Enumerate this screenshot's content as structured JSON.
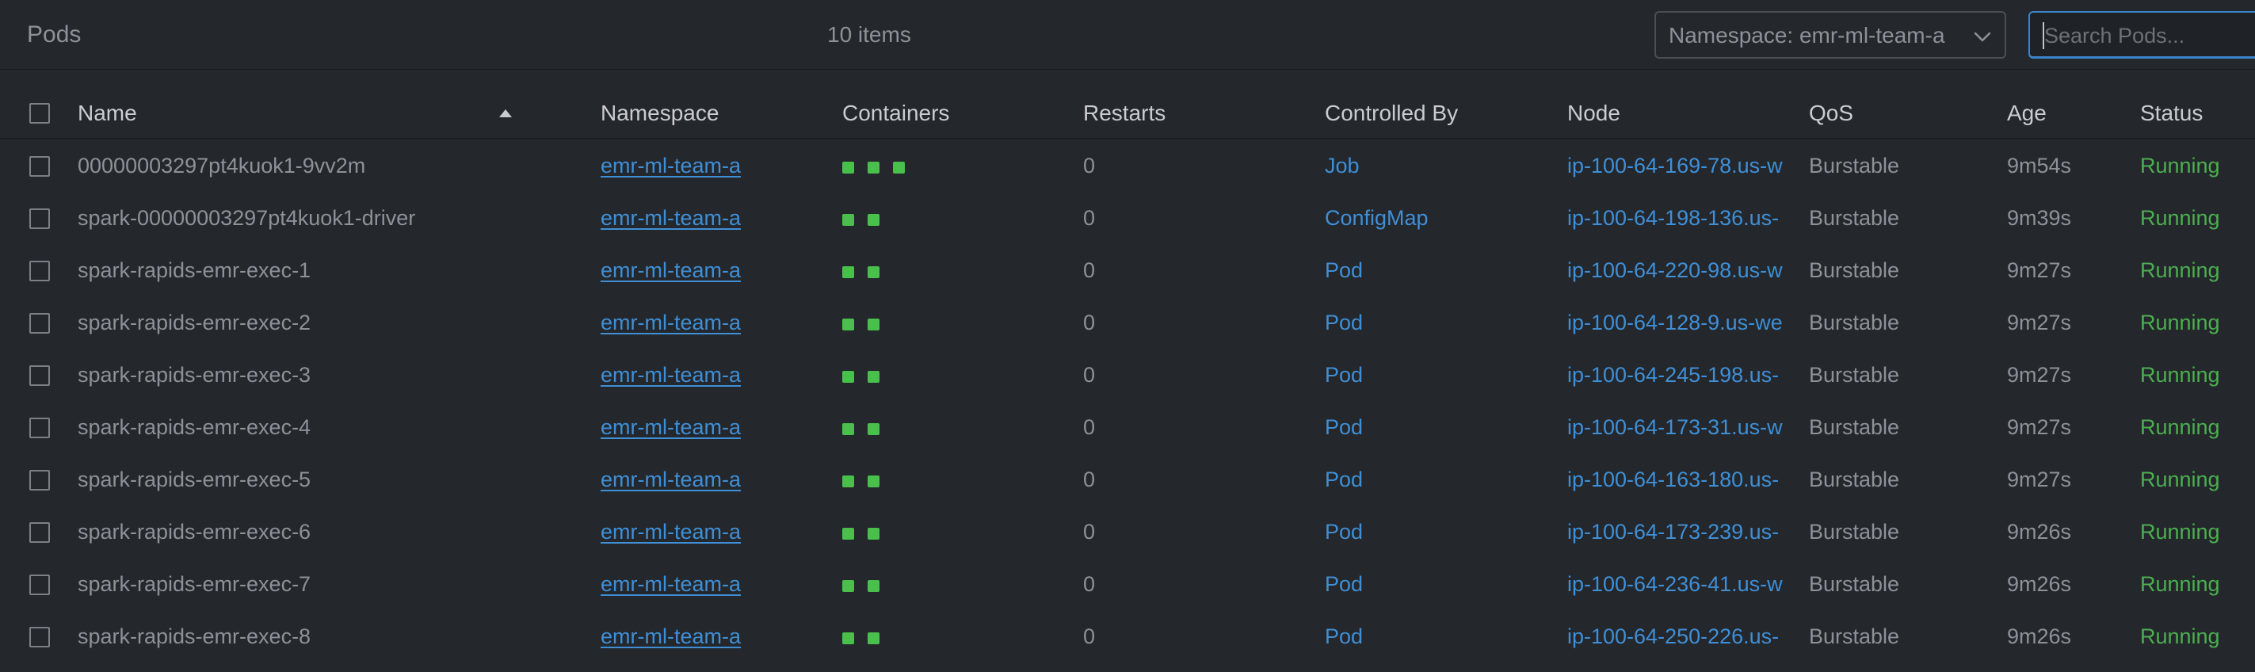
{
  "header": {
    "title": "Pods",
    "item_count": "10 items",
    "namespace_select": "Namespace: emr-ml-team-a",
    "search_placeholder": "Search Pods..."
  },
  "colors": {
    "background": "#24272c",
    "link": "#3f8fd6",
    "status_running": "#4caf50",
    "container_ready": "#48c04b",
    "search_focus": "#3a85c9"
  },
  "icons": {
    "namespace_dropdown": "chevron-down-icon",
    "sort": "sort-ascending-icon"
  },
  "columns": {
    "name": "Name",
    "namespace": "Namespace",
    "containers": "Containers",
    "restarts": "Restarts",
    "controlled_by": "Controlled By",
    "node": "Node",
    "qos": "QoS",
    "age": "Age",
    "status": "Status"
  },
  "sort": {
    "column": "Name",
    "direction": "ascending"
  },
  "rows": [
    {
      "name": "00000003297pt4kuok1-9vv2m",
      "namespace": "emr-ml-team-a",
      "containers": 3,
      "restarts": "0",
      "controlled_by": "Job",
      "node": "ip-100-64-169-78.us-w",
      "qos": "Burstable",
      "age": "9m54s",
      "status": "Running"
    },
    {
      "name": "spark-00000003297pt4kuok1-driver",
      "namespace": "emr-ml-team-a",
      "containers": 2,
      "restarts": "0",
      "controlled_by": "ConfigMap",
      "node": "ip-100-64-198-136.us-",
      "qos": "Burstable",
      "age": "9m39s",
      "status": "Running"
    },
    {
      "name": "spark-rapids-emr-exec-1",
      "namespace": "emr-ml-team-a",
      "containers": 2,
      "restarts": "0",
      "controlled_by": "Pod",
      "node": "ip-100-64-220-98.us-w",
      "qos": "Burstable",
      "age": "9m27s",
      "status": "Running"
    },
    {
      "name": "spark-rapids-emr-exec-2",
      "namespace": "emr-ml-team-a",
      "containers": 2,
      "restarts": "0",
      "controlled_by": "Pod",
      "node": "ip-100-64-128-9.us-we",
      "qos": "Burstable",
      "age": "9m27s",
      "status": "Running"
    },
    {
      "name": "spark-rapids-emr-exec-3",
      "namespace": "emr-ml-team-a",
      "containers": 2,
      "restarts": "0",
      "controlled_by": "Pod",
      "node": "ip-100-64-245-198.us-",
      "qos": "Burstable",
      "age": "9m27s",
      "status": "Running"
    },
    {
      "name": "spark-rapids-emr-exec-4",
      "namespace": "emr-ml-team-a",
      "containers": 2,
      "restarts": "0",
      "controlled_by": "Pod",
      "node": "ip-100-64-173-31.us-w",
      "qos": "Burstable",
      "age": "9m27s",
      "status": "Running"
    },
    {
      "name": "spark-rapids-emr-exec-5",
      "namespace": "emr-ml-team-a",
      "containers": 2,
      "restarts": "0",
      "controlled_by": "Pod",
      "node": "ip-100-64-163-180.us-",
      "qos": "Burstable",
      "age": "9m27s",
      "status": "Running"
    },
    {
      "name": "spark-rapids-emr-exec-6",
      "namespace": "emr-ml-team-a",
      "containers": 2,
      "restarts": "0",
      "controlled_by": "Pod",
      "node": "ip-100-64-173-239.us-",
      "qos": "Burstable",
      "age": "9m26s",
      "status": "Running"
    },
    {
      "name": "spark-rapids-emr-exec-7",
      "namespace": "emr-ml-team-a",
      "containers": 2,
      "restarts": "0",
      "controlled_by": "Pod",
      "node": "ip-100-64-236-41.us-w",
      "qos": "Burstable",
      "age": "9m26s",
      "status": "Running"
    },
    {
      "name": "spark-rapids-emr-exec-8",
      "namespace": "emr-ml-team-a",
      "containers": 2,
      "restarts": "0",
      "controlled_by": "Pod",
      "node": "ip-100-64-250-226.us-",
      "qos": "Burstable",
      "age": "9m26s",
      "status": "Running"
    }
  ]
}
